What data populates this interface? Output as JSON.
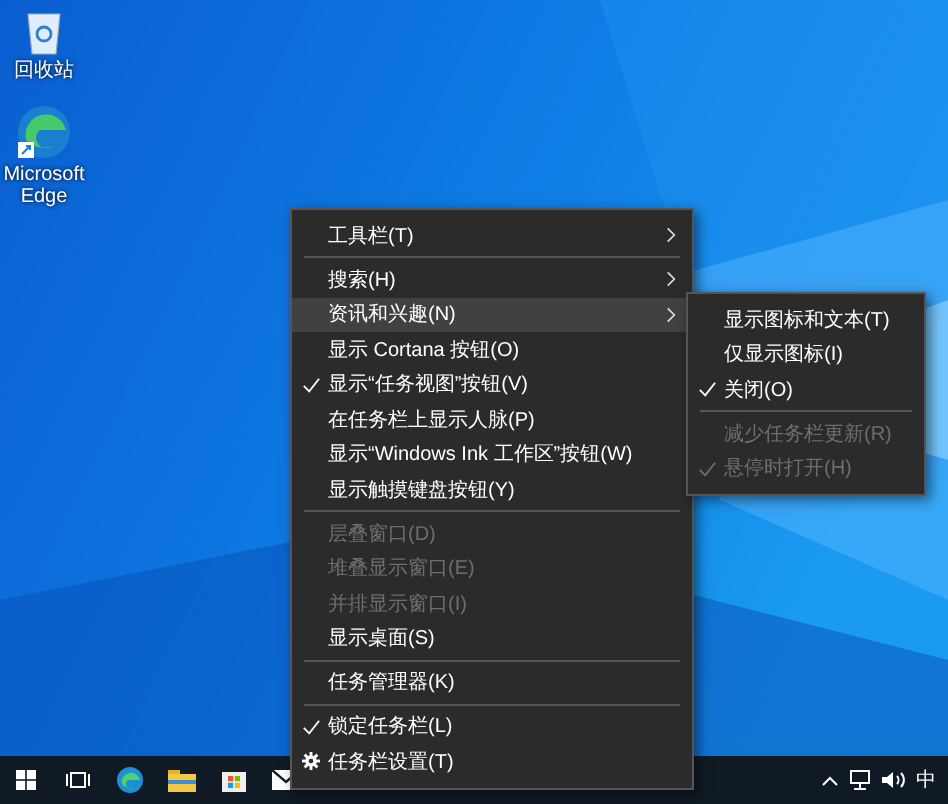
{
  "desktop_icons": [
    {
      "label": "回收站",
      "kind": "bin"
    },
    {
      "label": "Microsoft Edge",
      "kind": "edge"
    }
  ],
  "context_menu": {
    "items": [
      {
        "kind": "item",
        "label": "工具栏(T)",
        "checked": false,
        "disabled": false,
        "selected": false,
        "submenu": true
      },
      {
        "kind": "separator"
      },
      {
        "kind": "item",
        "label": "搜索(H)",
        "checked": false,
        "disabled": false,
        "selected": false,
        "submenu": true
      },
      {
        "kind": "item",
        "label": "资讯和兴趣(N)",
        "checked": false,
        "disabled": false,
        "selected": true,
        "submenu": true
      },
      {
        "kind": "item",
        "label": "显示 Cortana 按钮(O)",
        "checked": false,
        "disabled": false,
        "selected": false,
        "submenu": false
      },
      {
        "kind": "item",
        "label": "显示“任务视图”按钮(V)",
        "checked": true,
        "disabled": false,
        "selected": false,
        "submenu": false
      },
      {
        "kind": "item",
        "label": "在任务栏上显示人脉(P)",
        "checked": false,
        "disabled": false,
        "selected": false,
        "submenu": false
      },
      {
        "kind": "item",
        "label": "显示“Windows Ink 工作区”按钮(W)",
        "checked": false,
        "disabled": false,
        "selected": false,
        "submenu": false
      },
      {
        "kind": "item",
        "label": "显示触摸键盘按钮(Y)",
        "checked": false,
        "disabled": false,
        "selected": false,
        "submenu": false
      },
      {
        "kind": "separator"
      },
      {
        "kind": "item",
        "label": "层叠窗口(D)",
        "checked": false,
        "disabled": true,
        "selected": false,
        "submenu": false
      },
      {
        "kind": "item",
        "label": "堆叠显示窗口(E)",
        "checked": false,
        "disabled": true,
        "selected": false,
        "submenu": false
      },
      {
        "kind": "item",
        "label": "并排显示窗口(I)",
        "checked": false,
        "disabled": true,
        "selected": false,
        "submenu": false
      },
      {
        "kind": "item",
        "label": "显示桌面(S)",
        "checked": false,
        "disabled": false,
        "selected": false,
        "submenu": false
      },
      {
        "kind": "separator"
      },
      {
        "kind": "item",
        "label": "任务管理器(K)",
        "checked": false,
        "disabled": false,
        "selected": false,
        "submenu": false
      },
      {
        "kind": "separator"
      },
      {
        "kind": "item",
        "label": "锁定任务栏(L)",
        "checked": true,
        "disabled": false,
        "selected": false,
        "submenu": false
      },
      {
        "kind": "gear",
        "label": "任务栏设置(T)",
        "checked": false,
        "disabled": false,
        "selected": false,
        "submenu": false
      }
    ]
  },
  "submenu": {
    "items": [
      {
        "kind": "item",
        "label": "显示图标和文本(T)",
        "checked": false,
        "disabled": false
      },
      {
        "kind": "item",
        "label": "仅显示图标(I)",
        "checked": false,
        "disabled": false
      },
      {
        "kind": "item",
        "label": "关闭(O)",
        "checked": true,
        "disabled": false
      },
      {
        "kind": "separator"
      },
      {
        "kind": "item",
        "label": "减少任务栏更新(R)",
        "checked": false,
        "disabled": true
      },
      {
        "kind": "item",
        "label": "悬停时打开(H)",
        "checked": true,
        "disabled": true
      }
    ]
  },
  "taskbar": {
    "apps": [
      {
        "kind": "start"
      },
      {
        "kind": "taskview"
      },
      {
        "kind": "edge"
      },
      {
        "kind": "explorer"
      },
      {
        "kind": "store"
      },
      {
        "kind": "mail"
      }
    ],
    "tray": {
      "input_method": "中"
    }
  }
}
